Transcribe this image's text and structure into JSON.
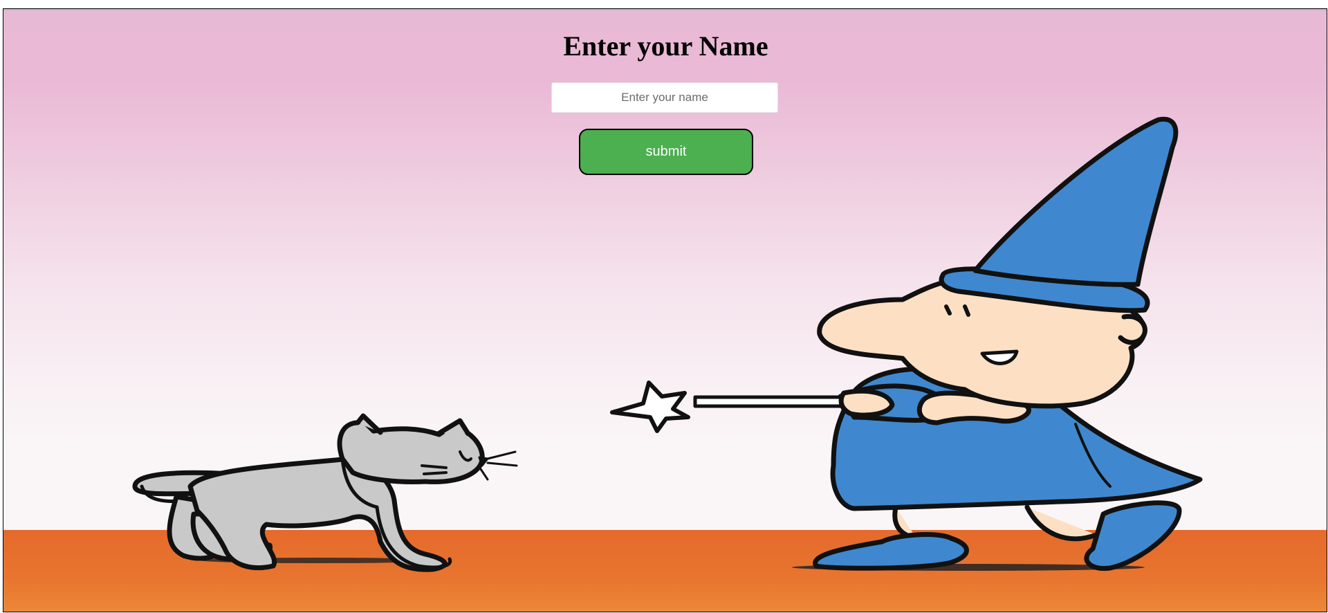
{
  "form": {
    "title": "Enter your Name",
    "name_input": {
      "value": "",
      "placeholder": "Enter your name"
    },
    "submit_label": "submit"
  },
  "illustration": {
    "figures": [
      "wizard-icon",
      "cat-icon",
      "star-wand-icon"
    ],
    "colors": {
      "sky_top": "#e8b9d4",
      "sky_bottom": "#faf6f8",
      "ground": "#e56a2c",
      "wizard_robe": "#3f88cf",
      "wizard_skin": "#fde0c4",
      "cat": "#c7c7c7",
      "submit_button": "#4caf50"
    }
  }
}
